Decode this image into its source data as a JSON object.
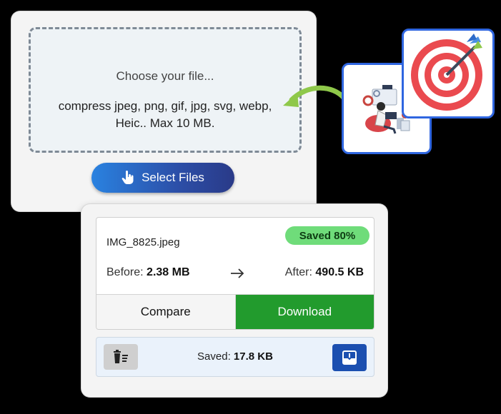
{
  "upload": {
    "choose_label": "Choose your file...",
    "formats_text": "compress jpeg, png, gif, jpg, svg, webp, Heic.. Max 10 MB.",
    "select_button": "Select Files",
    "button_icon": "pointer-hand-icon"
  },
  "result": {
    "file_name": "IMG_8825.jpeg",
    "saved_badge": "Saved 80%",
    "before_label": "Before:",
    "before_value": "2.38 MB",
    "after_label": "After:",
    "after_value": "490.5 KB",
    "compare_button": "Compare",
    "download_button": "Download"
  },
  "summary": {
    "saved_label": "Saved:",
    "saved_value": "17.8 KB",
    "delete_icon": "delete-list-icon",
    "save_icon": "save-download-icon"
  },
  "colors": {
    "download_green": "#229b2d",
    "badge_green": "#6fdc7a",
    "accent_blue": "#2f66e0"
  }
}
